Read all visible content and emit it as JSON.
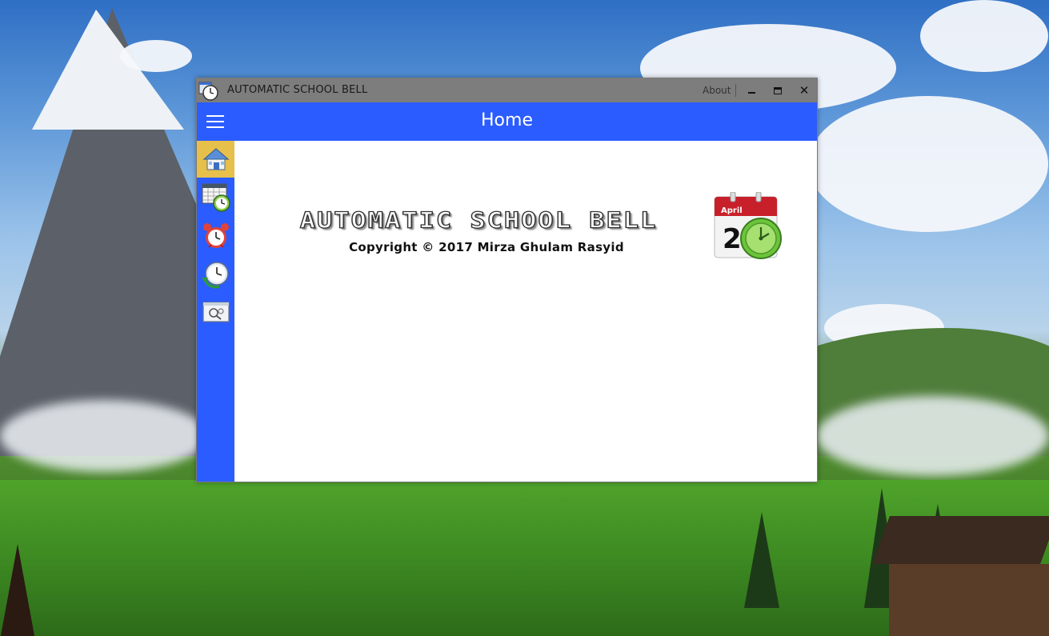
{
  "window": {
    "title": "AUTOMATIC SCHOOL BELL",
    "about_label": "About",
    "minimize_label": "",
    "maximize_label": "",
    "close_label": "✕"
  },
  "header": {
    "title": "Home"
  },
  "sidebar": {
    "items": [
      {
        "name": "home",
        "icon": "home-icon",
        "active": true
      },
      {
        "name": "schedule",
        "icon": "calendar-clock-icon",
        "active": false
      },
      {
        "name": "alarm",
        "icon": "alarm-clock-icon",
        "active": false
      },
      {
        "name": "time-sync",
        "icon": "clock-refresh-icon",
        "active": false
      },
      {
        "name": "settings",
        "icon": "search-settings-icon",
        "active": false
      }
    ]
  },
  "main": {
    "app_logo_text": "AUTOMATIC SCHOOL BELL",
    "copyright": "Copyright © 2017 Mirza Ghulam Rasyid",
    "calendar_month": "April",
    "calendar_day": "2"
  },
  "colors": {
    "accent": "#2b5cff",
    "titlebar": "#7d7d7d",
    "active_nav": "#e6c04a"
  }
}
